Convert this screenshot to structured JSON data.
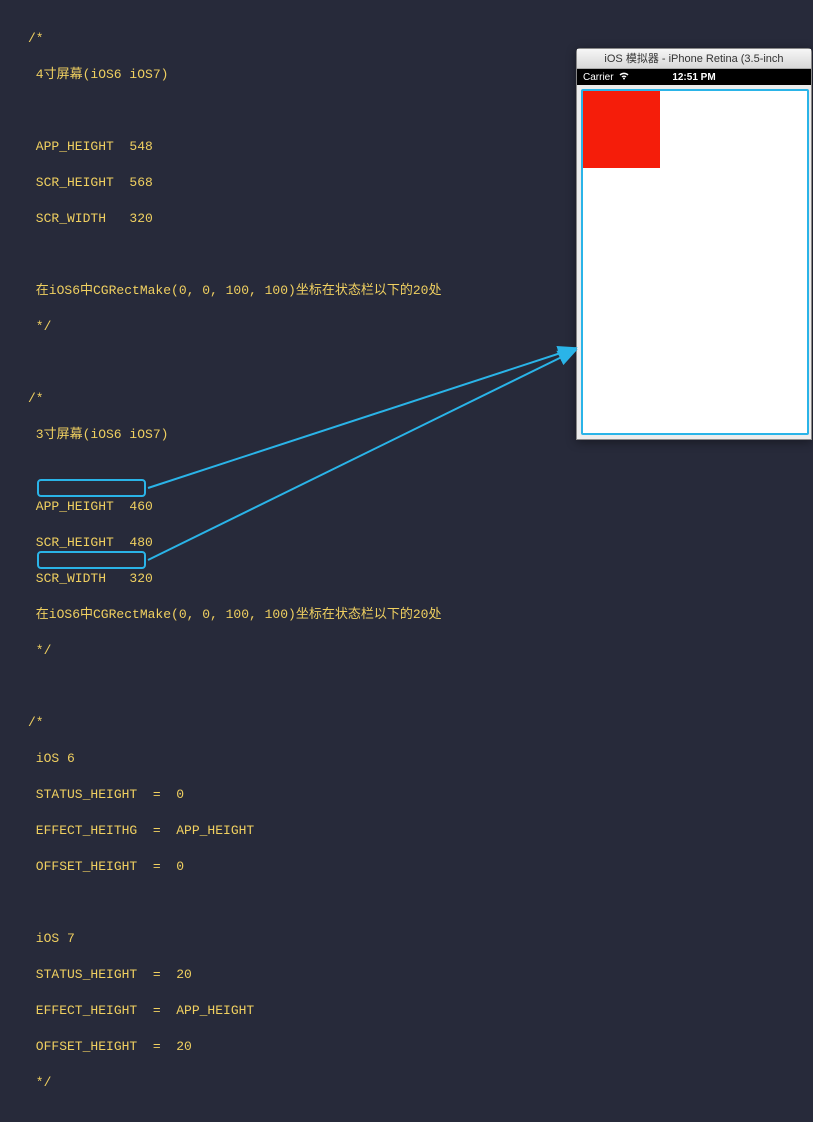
{
  "code": {
    "lines": [
      "/*",
      " 4寸屏幕(iOS6 iOS7)",
      "",
      " APP_HEIGHT  548",
      " SCR_HEIGHT  568",
      " SCR_WIDTH   320",
      "",
      " 在iOS6中CGRectMake(0, 0, 100, 100)坐标在状态栏以下的20处",
      " */",
      "",
      "/*",
      " 3寸屏幕(iOS6 iOS7)",
      "",
      " APP_HEIGHT  460",
      " SCR_HEIGHT  480",
      " SCR_WIDTH   320",
      " 在iOS6中CGRectMake(0, 0, 100, 100)坐标在状态栏以下的20处",
      " */",
      "",
      "/*",
      " iOS 6",
      " STATUS_HEIGHT  =  0",
      " EFFECT_HEITHG  =  APP_HEIGHT",
      " OFFSET_HEIGHT  =  0",
      "",
      " iOS 7",
      " STATUS_HEIGHT  =  20",
      " EFFECT_HEIGHT  =  APP_HEIGHT",
      " OFFSET_HEIGHT  =  20",
      " */"
    ]
  },
  "simulator": {
    "title": "iOS 模拟器 - iPhone Retina (3.5-inch",
    "statusbar": {
      "carrier": "Carrier",
      "time": "12:51 PM"
    }
  }
}
